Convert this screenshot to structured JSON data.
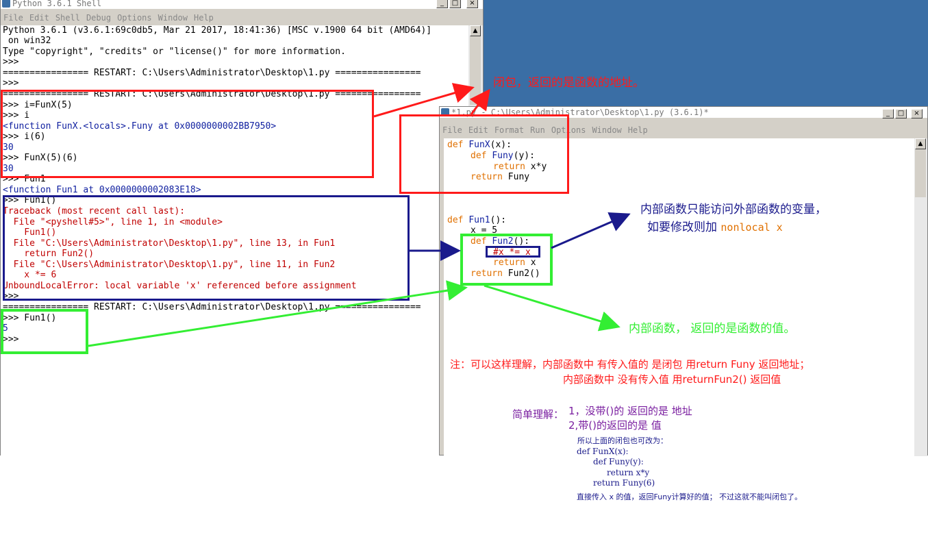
{
  "shell": {
    "title": "Python 3.6.1 Shell",
    "menu": [
      "File",
      "Edit",
      "Shell",
      "Debug",
      "Options",
      "Window",
      "Help"
    ],
    "lines": [
      "Python 3.6.1 (v3.6.1:69c0db5, Mar 21 2017, 18:41:36) [MSC v.1900 64 bit (AMD64)]",
      " on win32",
      "Type \"copyright\", \"credits\" or \"license()\" for more information.",
      ">>>",
      "================ RESTART: C:\\Users\\Administrator\\Desktop\\1.py ================",
      ">>>",
      "================ RESTART: C:\\Users\\Administrator\\Desktop\\1.py ================",
      ">>> i=FunX(5)",
      ">>> i",
      "<function FunX.<locals>.Funy at 0x0000000002BB7950>",
      ">>> i(6)",
      "30",
      ">>> FunX(5)(6)",
      "30",
      ">>> Fun1",
      "<function Fun1 at 0x0000000002083E18>",
      ">>> Fun1()",
      "Traceback (most recent call last):",
      "  File \"<pyshell#5>\", line 1, in <module>",
      "    Fun1()",
      "  File \"C:\\Users\\Administrator\\Desktop\\1.py\", line 13, in Fun1",
      "    return Fun2()",
      "  File \"C:\\Users\\Administrator\\Desktop\\1.py\", line 11, in Fun2",
      "    x *= 6",
      "UnboundLocalError: local variable 'x' referenced before assignment",
      ">>>",
      "================ RESTART: C:\\Users\\Administrator\\Desktop\\1.py ================",
      ">>> Fun1()",
      "5",
      ">>>"
    ]
  },
  "editor": {
    "title": "*1.py - C:\\Users\\Administrator\\Desktop\\1.py (3.6.1)*",
    "menu": [
      "File",
      "Edit",
      "Format",
      "Run",
      "Options",
      "Window",
      "Help"
    ],
    "code": {
      "l1_kw": "def",
      "l1_name": "FunX",
      "l1_rest": "(x):",
      "l2_kw": "def",
      "l2_name": "Funy",
      "l2_rest": "(y):",
      "l3_kw": "return",
      "l3_rest": "x*y",
      "l4_kw": "return",
      "l4_rest": "Funy",
      "l5_kw": "def",
      "l5_name": "Fun1",
      "l5_rest": "():",
      "l6": "x = 5",
      "l7_kw": "def",
      "l7_name": "Fun2",
      "l7_rest": "():",
      "l8_comment": "#x *= x",
      "l9_kw": "return",
      "l9_rest": "x",
      "l10_kw": "return",
      "l10_rest": "Fun2()"
    }
  },
  "annotations": {
    "closure": "闭包，返回的是函数的地址。",
    "inner_access_1": "内部函数只能访问外部函数的变量，",
    "inner_access_2": "如要修改则加",
    "nonlocal": "nonlocal x",
    "inner_value": "内部函数，  返回的是函数的值。",
    "note_1": "注：可以这样理解，内部函数中 有传入值的  是闭包  用return Funy 返回地址；",
    "note_2": "内部函数中 没有传入值   用returnFun2() 返回值",
    "simple_label": "简单理解：",
    "simple_1": "1，没带()的 返回的是 地址",
    "simple_2": "2,带()的返回的是 值",
    "alt_intro": "所以上面的闭包也可改为：",
    "alt_1": "def FunX(x):",
    "alt_2": "def Funy(y):",
    "alt_3": "return x*y",
    "alt_4": "return Funy(6)",
    "alt_end": "直接传入 x 的值，返回Funy计算好的值；  不过这就不能叫闭包了。"
  },
  "colors": {
    "red": "#ff1a1a",
    "navy": "#1a1a8c",
    "green": "#33ee33",
    "keyword": "#e07000",
    "defname": "#1020a0",
    "purple": "#7a1fa0"
  }
}
